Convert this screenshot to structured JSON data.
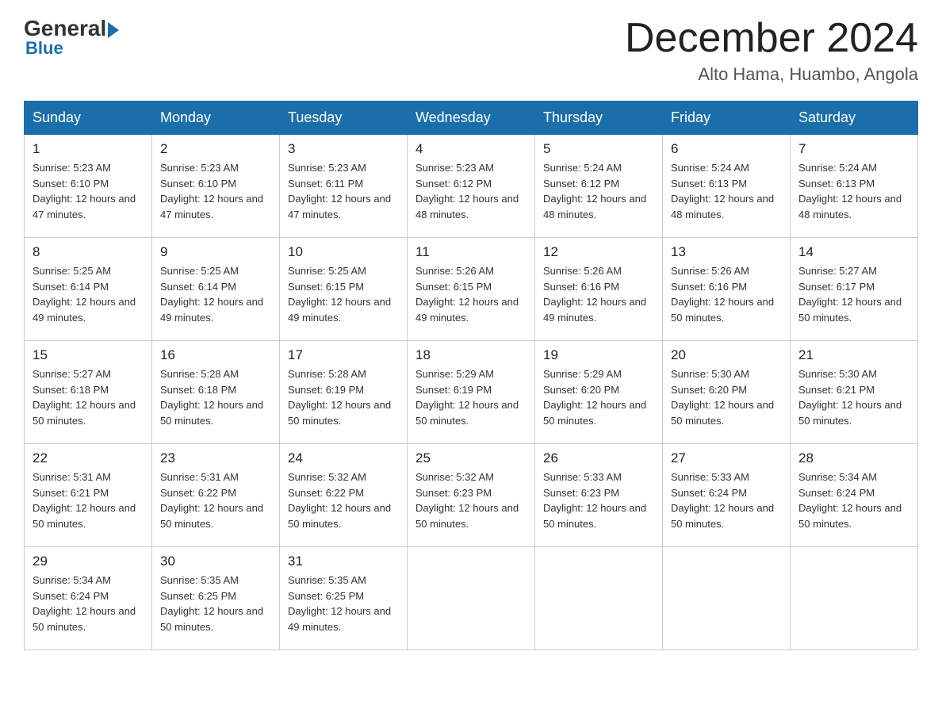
{
  "header": {
    "logo": {
      "general": "General",
      "blue": "Blue"
    },
    "title": "December 2024",
    "location": "Alto Hama, Huambo, Angola"
  },
  "weekdays": [
    "Sunday",
    "Monday",
    "Tuesday",
    "Wednesday",
    "Thursday",
    "Friday",
    "Saturday"
  ],
  "weeks": [
    [
      {
        "day": "1",
        "sunrise": "5:23 AM",
        "sunset": "6:10 PM",
        "daylight": "12 hours and 47 minutes."
      },
      {
        "day": "2",
        "sunrise": "5:23 AM",
        "sunset": "6:10 PM",
        "daylight": "12 hours and 47 minutes."
      },
      {
        "day": "3",
        "sunrise": "5:23 AM",
        "sunset": "6:11 PM",
        "daylight": "12 hours and 47 minutes."
      },
      {
        "day": "4",
        "sunrise": "5:23 AM",
        "sunset": "6:12 PM",
        "daylight": "12 hours and 48 minutes."
      },
      {
        "day": "5",
        "sunrise": "5:24 AM",
        "sunset": "6:12 PM",
        "daylight": "12 hours and 48 minutes."
      },
      {
        "day": "6",
        "sunrise": "5:24 AM",
        "sunset": "6:13 PM",
        "daylight": "12 hours and 48 minutes."
      },
      {
        "day": "7",
        "sunrise": "5:24 AM",
        "sunset": "6:13 PM",
        "daylight": "12 hours and 48 minutes."
      }
    ],
    [
      {
        "day": "8",
        "sunrise": "5:25 AM",
        "sunset": "6:14 PM",
        "daylight": "12 hours and 49 minutes."
      },
      {
        "day": "9",
        "sunrise": "5:25 AM",
        "sunset": "6:14 PM",
        "daylight": "12 hours and 49 minutes."
      },
      {
        "day": "10",
        "sunrise": "5:25 AM",
        "sunset": "6:15 PM",
        "daylight": "12 hours and 49 minutes."
      },
      {
        "day": "11",
        "sunrise": "5:26 AM",
        "sunset": "6:15 PM",
        "daylight": "12 hours and 49 minutes."
      },
      {
        "day": "12",
        "sunrise": "5:26 AM",
        "sunset": "6:16 PM",
        "daylight": "12 hours and 49 minutes."
      },
      {
        "day": "13",
        "sunrise": "5:26 AM",
        "sunset": "6:16 PM",
        "daylight": "12 hours and 50 minutes."
      },
      {
        "day": "14",
        "sunrise": "5:27 AM",
        "sunset": "6:17 PM",
        "daylight": "12 hours and 50 minutes."
      }
    ],
    [
      {
        "day": "15",
        "sunrise": "5:27 AM",
        "sunset": "6:18 PM",
        "daylight": "12 hours and 50 minutes."
      },
      {
        "day": "16",
        "sunrise": "5:28 AM",
        "sunset": "6:18 PM",
        "daylight": "12 hours and 50 minutes."
      },
      {
        "day": "17",
        "sunrise": "5:28 AM",
        "sunset": "6:19 PM",
        "daylight": "12 hours and 50 minutes."
      },
      {
        "day": "18",
        "sunrise": "5:29 AM",
        "sunset": "6:19 PM",
        "daylight": "12 hours and 50 minutes."
      },
      {
        "day": "19",
        "sunrise": "5:29 AM",
        "sunset": "6:20 PM",
        "daylight": "12 hours and 50 minutes."
      },
      {
        "day": "20",
        "sunrise": "5:30 AM",
        "sunset": "6:20 PM",
        "daylight": "12 hours and 50 minutes."
      },
      {
        "day": "21",
        "sunrise": "5:30 AM",
        "sunset": "6:21 PM",
        "daylight": "12 hours and 50 minutes."
      }
    ],
    [
      {
        "day": "22",
        "sunrise": "5:31 AM",
        "sunset": "6:21 PM",
        "daylight": "12 hours and 50 minutes."
      },
      {
        "day": "23",
        "sunrise": "5:31 AM",
        "sunset": "6:22 PM",
        "daylight": "12 hours and 50 minutes."
      },
      {
        "day": "24",
        "sunrise": "5:32 AM",
        "sunset": "6:22 PM",
        "daylight": "12 hours and 50 minutes."
      },
      {
        "day": "25",
        "sunrise": "5:32 AM",
        "sunset": "6:23 PM",
        "daylight": "12 hours and 50 minutes."
      },
      {
        "day": "26",
        "sunrise": "5:33 AM",
        "sunset": "6:23 PM",
        "daylight": "12 hours and 50 minutes."
      },
      {
        "day": "27",
        "sunrise": "5:33 AM",
        "sunset": "6:24 PM",
        "daylight": "12 hours and 50 minutes."
      },
      {
        "day": "28",
        "sunrise": "5:34 AM",
        "sunset": "6:24 PM",
        "daylight": "12 hours and 50 minutes."
      }
    ],
    [
      {
        "day": "29",
        "sunrise": "5:34 AM",
        "sunset": "6:24 PM",
        "daylight": "12 hours and 50 minutes."
      },
      {
        "day": "30",
        "sunrise": "5:35 AM",
        "sunset": "6:25 PM",
        "daylight": "12 hours and 50 minutes."
      },
      {
        "day": "31",
        "sunrise": "5:35 AM",
        "sunset": "6:25 PM",
        "daylight": "12 hours and 49 minutes."
      },
      null,
      null,
      null,
      null
    ]
  ]
}
